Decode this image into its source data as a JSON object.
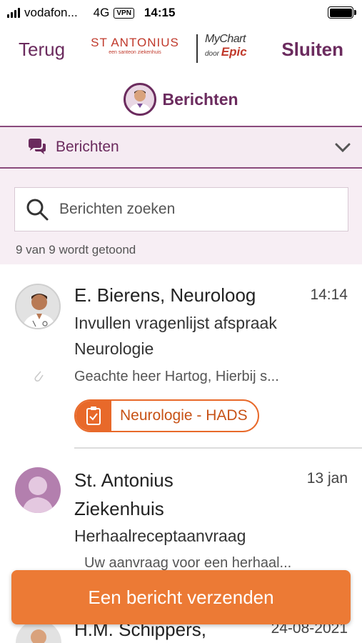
{
  "status_bar": {
    "carrier": "vodafon...",
    "network": "4G",
    "vpn": "VPN",
    "time": "14:15"
  },
  "header": {
    "back_label": "Terug",
    "close_label": "Sluiten",
    "logo_antonius_name": "ST ANTONIUS",
    "logo_antonius_tag": "een santeon ziekenhuis",
    "logo_mychart": "MyChart",
    "logo_door": "door",
    "logo_epic": "Epic"
  },
  "page_title": "Berichten",
  "section": {
    "label": "Berichten"
  },
  "search": {
    "placeholder": "Berichten zoeken",
    "count_text": "9 van 9 wordt getoond"
  },
  "messages": [
    {
      "sender": "E. Bierens, Neuroloog",
      "time": "14:14",
      "subject_line1": "Invullen vragenlijst afspraak",
      "subject_line2": "Neurologie",
      "preview": "Geachte heer Hartog,   Hierbij s...",
      "tag": "Neurologie - HADS"
    },
    {
      "sender_line1": "St. Antonius",
      "sender_line2": "Ziekenhuis",
      "time": "13 jan",
      "subject": "Herhaalreceptaanvraag",
      "preview": "Uw aanvraag voor een herhaal..."
    },
    {
      "sender_partial": "H.M. Schippers,",
      "time_partial": "24-08-2021"
    }
  ],
  "send_button": "Een bericht verzenden",
  "colors": {
    "brand_purple": "#6b2b5e",
    "accent_orange": "#ec7a35",
    "section_bg": "#f5ebf2"
  }
}
